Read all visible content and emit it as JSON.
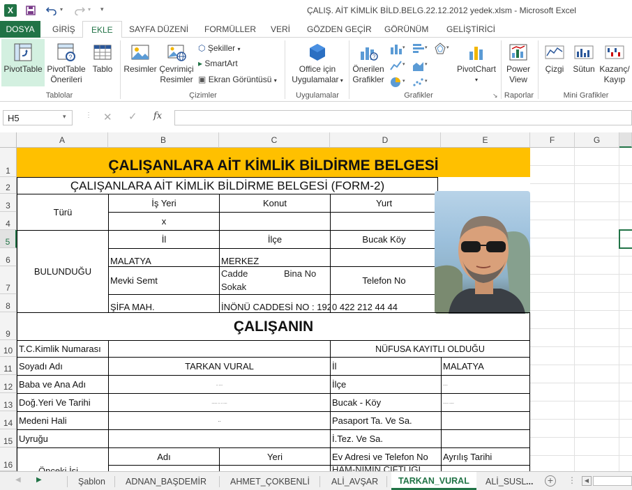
{
  "window": {
    "title": "ÇALIŞ. AİT KİMLİK BİLD.BELG.22.12.2012 yedek.xlsm - Microsoft Excel"
  },
  "ribbon_tabs": [
    "DOSYA",
    "GİRİŞ",
    "EKLE",
    "SAYFA DÜZENİ",
    "FORMÜLLER",
    "VERİ",
    "GÖZDEN GEÇİR",
    "GÖRÜNÜM",
    "GELİŞTİRİCİ"
  ],
  "ribbon": {
    "pivottable": "PivotTable",
    "pivottable_rec_1": "PivotTable",
    "pivottable_rec_2": "Önerileri",
    "table": "Tablo",
    "pictures": "Resimler",
    "online_pictures_1": "Çevrimiçi",
    "online_pictures_2": "Resimler",
    "shapes": "Şekiller",
    "smartart": "SmartArt",
    "screenshot": "Ekran Görüntüsü",
    "office_apps_1": "Office için",
    "office_apps_2": "Uygulamalar",
    "rec_charts_1": "Önerilen",
    "rec_charts_2": "Grafikler",
    "pivotchart": "PivotChart",
    "power_view_1": "Power",
    "power_view_2": "View",
    "spark_line": "Çizgi",
    "spark_column": "Sütun",
    "spark_winloss_1": "Kazanç/",
    "spark_winloss_2": "Kayıp",
    "groups": {
      "tables": "Tablolar",
      "illustrations": "Çizimler",
      "apps": "Uygulamalar",
      "charts": "Grafikler",
      "reports": "Raporlar",
      "sparklines": "Mini Grafikler"
    }
  },
  "formula_bar": {
    "name_box": "H5",
    "fx": "fx",
    "formula": ""
  },
  "columns": [
    "A",
    "B",
    "C",
    "D",
    "E",
    "F",
    "G"
  ],
  "rows": [
    "1",
    "2",
    "3",
    "4",
    "5",
    "6",
    "7",
    "8",
    "9",
    "10",
    "11",
    "12",
    "13",
    "14",
    "15",
    "16"
  ],
  "sheet": {
    "header_title": "ÇALIŞANLARA AİT KİMLİK BİLDİRME BELGESİ",
    "form_title": "ÇALIŞANLARA AİT KİMLİK BİLDİRME BELGESİ (FORM-2)",
    "turu": "Türü",
    "is_yeri": "İş Yeri",
    "konut": "Konut",
    "yurt": "Yurt",
    "x_mark": "x",
    "bulundugu": "BULUNDUĞU",
    "il": "İl",
    "ilce": "İlçe",
    "bucak_koy": "Bucak Köy",
    "malatya": "MALATYA",
    "merkez": "MERKEZ",
    "mevki_semt": "Mevki Semt",
    "cadde": "Cadde",
    "bina_no": "Bina No",
    "sokak": "Sokak",
    "telefon_no": "Telefon No",
    "sifa_mah": "ŞİFA MAH.",
    "inonu": "İNÖNÜ CADDESİ NO : 192",
    "telefon": "0 422 212 44 44",
    "calisanin": "ÇALIŞANIN",
    "tc": "T.C.Kimlik Numarası",
    "nufus": "NÜFUSA KAYITLI OLDUĞU",
    "soyadi_adi": "Soyadı Adı",
    "soyadi_value": "TARKAN VURAL",
    "il2": "İl",
    "malatya2": "MALATYA",
    "baba_ana": "Baba ve Ana Adı",
    "ilce2": "İlçe",
    "dog_yeri": "Doğ.Yeri Ve Tarihi",
    "bucak_koy2": "Bucak - Köy",
    "medeni": "Medeni Hali",
    "pasaport": "Pasaport Ta. Ve Sa.",
    "uyrugu": "Uyruğu",
    "itez": "İ.Tez. Ve Sa.",
    "adi": "Adı",
    "yeri": "Yeri",
    "ev_adresi": "Ev Adresi ve Telefon No",
    "ayrilis": "Ayrılış Tarihi",
    "onceki": "Önceki İşi",
    "ham_nimin": "HAM-NIMIN ÇİFTLİĞİ",
    "medeni_val": "..",
    "baba_val": "-- ----",
    "dog_val": "------ -- -- ----",
    "ilce_val": "-----",
    "bucak_val": "------ -----"
  },
  "sheet_tabs": [
    "Şablon",
    "ADNAN_BAŞDEMİR",
    "AHMET_ÇOKBENLİ",
    "ALİ_AVŞAR",
    "TARKAN_VURAL",
    "ALİ_SUSL"
  ],
  "sheet_more": "...",
  "colors": {
    "excel_green": "#217346",
    "header_fill": "#FFC000"
  }
}
